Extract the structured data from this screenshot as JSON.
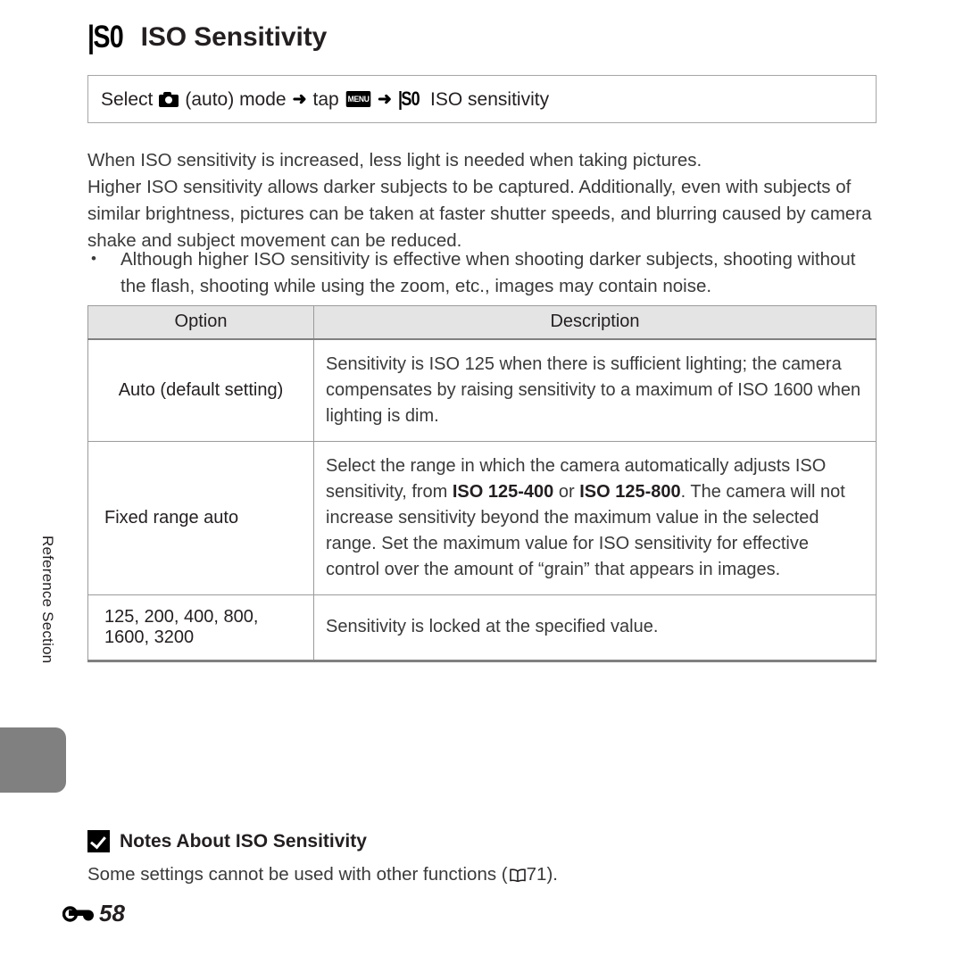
{
  "page": {
    "side_tab_label": "Reference Section",
    "folio_number": "58",
    "folio_icon": "reference-section-icon"
  },
  "title": {
    "iso_icon": "iso-icon",
    "text": "ISO Sensitivity"
  },
  "navigation": {
    "segments": [
      {
        "type": "text",
        "value": "Select"
      },
      {
        "type": "icon",
        "value": "camera-auto-mode-icon"
      },
      {
        "type": "text",
        "value": "(auto) mode"
      },
      {
        "type": "arrow",
        "value": "➜"
      },
      {
        "type": "text",
        "value": "tap"
      },
      {
        "type": "icon",
        "value": "menu-button-icon",
        "label": "MENU"
      },
      {
        "type": "arrow",
        "value": "➜"
      },
      {
        "type": "icon",
        "value": "iso-icon"
      },
      {
        "type": "text",
        "value": "ISO sensitivity"
      }
    ],
    "parts": {
      "select": "Select",
      "auto_mode": "(auto) mode",
      "tap": "tap",
      "menu_label": "MENU",
      "iso_sensitivity": "ISO sensitivity",
      "arrow": "➜"
    }
  },
  "body": {
    "paragraph_1": "When ISO sensitivity is increased, less light is needed when taking pictures.",
    "paragraph_2": "Higher ISO sensitivity allows darker subjects to be captured. Additionally, even with subjects of similar brightness, pictures can be taken at faster shutter speeds, and blurring caused by camera shake and subject movement can be reduced.",
    "bullets": [
      "Although higher ISO sensitivity is effective when shooting darker subjects, shooting without the flash, shooting while using the zoom, etc., images may contain noise."
    ]
  },
  "table": {
    "headers": [
      "Option",
      "Description"
    ],
    "rows": [
      {
        "option": "Auto (default setting)",
        "description_plain": "Sensitivity is ISO 125 when there is sufficient lighting; the camera compensates by raising sensitivity to a maximum of ISO 1600 when lighting is dim.",
        "description_html": "Sensitivity is ISO 125 when there is sufficient lighting; the camera compensates by raising sensitivity to a maximum of ISO 1600 when lighting is dim."
      },
      {
        "option": "Fixed range auto",
        "description_plain": "Select the range in which the camera automatically adjusts ISO sensitivity, from ISO 125-400 or ISO 125-800. The camera will not increase sensitivity beyond the maximum value in the selected range. Set the maximum value for ISO sensitivity for effective control over the amount of “grain” that appears in images.",
        "description_html": "Select the range in which the camera automatically adjusts ISO sensitivity, from <b>ISO 125-400</b> or <b>ISO 125-800</b>. The camera will not increase sensitivity beyond the maximum value in the selected range. Set the maximum value for ISO sensitivity for effective control over the amount of “grain” that appears in images."
      },
      {
        "option": "125, 200, 400, 800, 1600, 3200",
        "description_plain": "Sensitivity is locked at the specified value.",
        "description_html": "Sensitivity is locked at the specified value."
      }
    ]
  },
  "notes": {
    "icon": "checkmark-icon",
    "title": "Notes About ISO Sensitivity",
    "text_before_ref": "Some settings cannot be used with other functions (",
    "reference_icon": "book-icon",
    "reference_page": "71",
    "text_after_ref": ")."
  }
}
